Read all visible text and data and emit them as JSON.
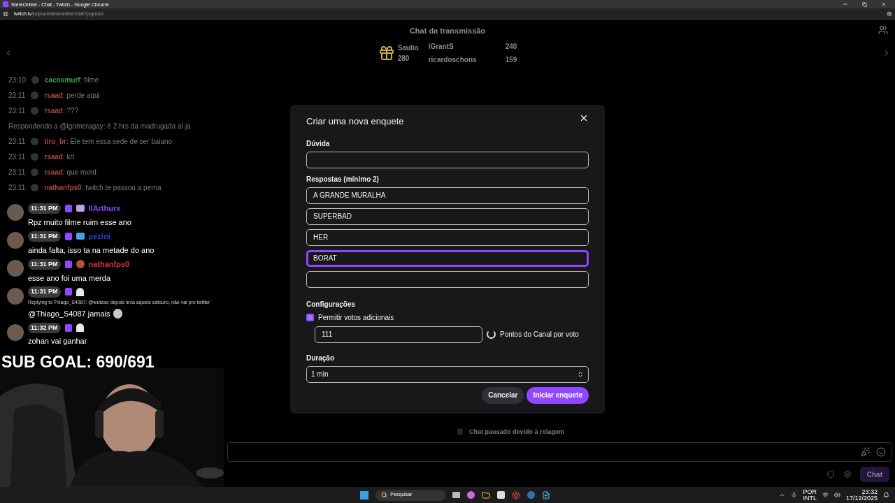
{
  "window": {
    "title": "StereOnline - Chat - Twitch - Google Chrome",
    "url_host": "twitch.tv",
    "url_path": "/popout/stereonline/chat?popout="
  },
  "chat": {
    "header": "Chat da transmissão",
    "leaderboard": [
      {
        "name": "Saulio",
        "score": "280"
      },
      {
        "name": "iGrantS",
        "score": "240"
      },
      {
        "name": "ricardoschons",
        "score": "159"
      }
    ],
    "messages": [
      {
        "kind": "message",
        "time": "23:10",
        "user": "cacosmurf",
        "color": "#4a9a4e",
        "text": ": filme"
      },
      {
        "kind": "message",
        "time": "23:11",
        "user": "rsaad",
        "color": "#a84444",
        "text": ": perde aqui"
      },
      {
        "kind": "message",
        "time": "23:11",
        "user": "rsaad",
        "color": "#a84444",
        "text": ": ???"
      },
      {
        "kind": "reply",
        "text": "Respondendo a @igomeragay: é 2 hrs da madrugada aí ja"
      },
      {
        "kind": "message",
        "time": "23:11",
        "user": "tiro_br",
        "color": "#a84444",
        "text": ": Ele tem essa sede de ser baiano"
      },
      {
        "kind": "message",
        "time": "23:11",
        "user": "rsaad",
        "color": "#a84444",
        "text": ": krl"
      },
      {
        "kind": "message",
        "time": "23:11",
        "user": "rsaad",
        "color": "#a84444",
        "text": ": que merd"
      },
      {
        "kind": "message",
        "time": "23:11",
        "user": "nathanfps0",
        "color": "#a84444",
        "text": ": twitch te passou a perna"
      }
    ],
    "paused": "Chat pausado devido à rolagem",
    "send": "Chat"
  },
  "overlay": {
    "messages": [
      {
        "time": "11:31 PM",
        "user": "IIArthurx",
        "color": "#9146ff",
        "kind": "tv",
        "text": "Rpz muito filme ruim esse ano"
      },
      {
        "time": "11:31 PM",
        "user": "pezini",
        "color": "#1e3fd6",
        "kind": "crown",
        "text": "ainda falta, isso ta na metade do ano"
      },
      {
        "time": "11:31 PM",
        "user": "nathanfps0",
        "color": "#e0304a",
        "kind": "face",
        "text": "esse ano foi uma merda"
      },
      {
        "time": "11:31 PM",
        "kind": "skull",
        "reply": "Replying to Thiago_S4087: @wutzao depois leva aquele estouro, não vai pro twitter",
        "text": "@Thiago_S4087 jamais",
        "emote": true
      },
      {
        "time": "11:32 PM",
        "kind": "skull",
        "text": "zohan vai ganhar"
      }
    ],
    "goal": "SUB GOAL: 690/691"
  },
  "poll": {
    "title": "Criar uma nova enquete",
    "question_label": "Dúvida",
    "answers_label": "Respostas (mínimo 2)",
    "answers": [
      {
        "value": "A GRANDE MURALHA",
        "focused": false
      },
      {
        "value": "SUPERBAD",
        "focused": false
      },
      {
        "value": "HER",
        "focused": false
      },
      {
        "value": "BORAT",
        "focused": true
      },
      {
        "focused": false
      }
    ],
    "settings_label": "Configurações",
    "extra_votes": {
      "label": "Permitir votos adicionais",
      "checked": true
    },
    "points": "111",
    "points_label": "Pontos do Canal por voto",
    "duration_label": "Duração",
    "duration": "1 min",
    "cancel": "Cancelar",
    "start": "Iniciar enquete"
  },
  "taskbar": {
    "search": "Pesquisar",
    "lang": "POR",
    "layout": "INTL",
    "time": "23:32",
    "date": "17/12/2025"
  }
}
